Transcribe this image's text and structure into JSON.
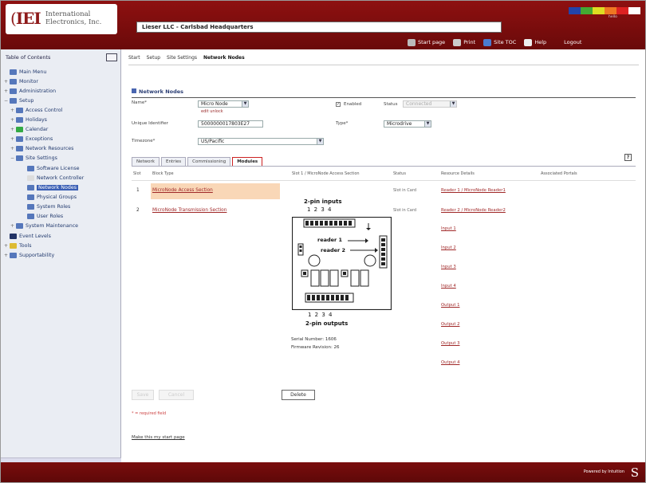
{
  "brand": {
    "logo_mark": "IEI",
    "logo_text_line1": "International",
    "logo_text_line2": "Electronics, Inc.",
    "site_title": "Lieser LLC - Carlsbad Headquarters",
    "color_bar": [
      "#2244aa",
      "#44aa33",
      "#dddd22",
      "#ee7722",
      "#dd2222",
      "#ffffff"
    ],
    "color_caption": "hello"
  },
  "toolbar": {
    "start_page": "Start page",
    "print": "Print",
    "site_tree": "Site TOC",
    "help": "Help",
    "logout": "Logout"
  },
  "sidebar": {
    "title": "Table of Contents",
    "items": [
      {
        "label": "Main Menu",
        "exp": "",
        "icon": "home-icon",
        "color": "#5577bb"
      },
      {
        "label": "Monitor",
        "exp": "+",
        "icon": "monitor-icon",
        "color": "#5577bb"
      },
      {
        "label": "Administration",
        "exp": "+",
        "icon": "admin-icon",
        "color": "#5577bb"
      },
      {
        "label": "Setup",
        "exp": "−",
        "icon": "setup-icon",
        "color": "#5577bb"
      },
      {
        "label": "Access Control",
        "exp": "+",
        "icon": "lock-icon",
        "color": "#5577bb"
      },
      {
        "label": "Holidays",
        "exp": "+",
        "icon": "calendar-icon",
        "color": "#5577bb"
      },
      {
        "label": "Calendar",
        "exp": "+",
        "icon": "calendar-icon",
        "color": "#33aa44"
      },
      {
        "label": "Exceptions",
        "exp": "+",
        "icon": "exception-icon",
        "color": "#5577bb"
      },
      {
        "label": "Network Resources",
        "exp": "+",
        "icon": "network-icon",
        "color": "#5577bb"
      },
      {
        "label": "Site Settings",
        "exp": "−",
        "icon": "folder-icon",
        "color": "#5577bb"
      },
      {
        "label": "Software License",
        "exp": "",
        "icon": "license-icon",
        "color": "#5577bb"
      },
      {
        "label": "Network Controller",
        "exp": "",
        "icon": "controller-icon",
        "color": "#dddddd"
      },
      {
        "label": "Network Nodes",
        "exp": "",
        "icon": "node-icon",
        "color": "#5577bb"
      },
      {
        "label": "Physical Groups",
        "exp": "",
        "icon": "group-icon",
        "color": "#5577bb"
      },
      {
        "label": "System Roles",
        "exp": "",
        "icon": "roles-icon",
        "color": "#5577bb"
      },
      {
        "label": "User Roles",
        "exp": "",
        "icon": "user-icon",
        "color": "#5577bb"
      },
      {
        "label": "System Maintenance",
        "exp": "+",
        "icon": "maintenance-icon",
        "color": "#5577bb"
      },
      {
        "label": "Event Levels",
        "exp": "",
        "icon": "levels-icon",
        "color": "#223366"
      },
      {
        "label": "Tools",
        "exp": "+",
        "icon": "tools-icon",
        "color": "#ddbb33"
      },
      {
        "label": "Supportability",
        "exp": "+",
        "icon": "support-icon",
        "color": "#5577bb"
      }
    ]
  },
  "breadcrumb": [
    "Start",
    "Setup",
    "Site Settings",
    "Network Nodes"
  ],
  "section": {
    "title": "Network Nodes",
    "name_label": "Name*",
    "name_value": "Micro Node",
    "name_link": "edit  unlock",
    "enabled_label": "Enabled",
    "status_label": "Status",
    "status_value": "Connected",
    "unique_id_label": "Unique Identifier",
    "unique_id_value": "5000000017803E27",
    "type_label": "Type*",
    "type_value": "Microdrive",
    "timezone_label": "Timezone*",
    "timezone_value": "US/Pacific"
  },
  "tabs": [
    "Network",
    "Entries",
    "Commissioning",
    "Modules"
  ],
  "grid": {
    "headers": [
      "Slot",
      "Block Type",
      "Slot 1 / MicroNode Access Section",
      "Status",
      "Resource Details",
      "Associated Portals"
    ],
    "rows": [
      {
        "slot": "1",
        "type": "MicroNode Access Section",
        "status": "Slot in Card",
        "resource": "Reader 1 / MicroNode Reader1"
      },
      {
        "slot": "2",
        "type": "MicroNode Transmission Section",
        "status": "Slot in Card",
        "resource": "Reader 2 / MicroNode Reader2"
      }
    ],
    "resource_links": [
      "Input 1",
      "Input 2",
      "Input 3",
      "Input 4",
      "Output 1",
      "Output 2",
      "Output 3",
      "Output 4"
    ]
  },
  "diagram": {
    "top_caption": "2-pin inputs",
    "top_numbers": "1 2 3 4",
    "reader1": "reader 1",
    "reader2": "reader 2",
    "bottom_numbers": "1  2  3  4",
    "bottom_caption": "2-pin outputs",
    "serial": "Serial Number:  1606",
    "firmware": "Firmware Revision:  26"
  },
  "buttons": {
    "save": "Save",
    "cancel": "Cancel",
    "delete": "Delete"
  },
  "required_note": "* = required field",
  "footer_link": "Make this my start page",
  "footer": {
    "powered": "Powered by Intuition"
  }
}
